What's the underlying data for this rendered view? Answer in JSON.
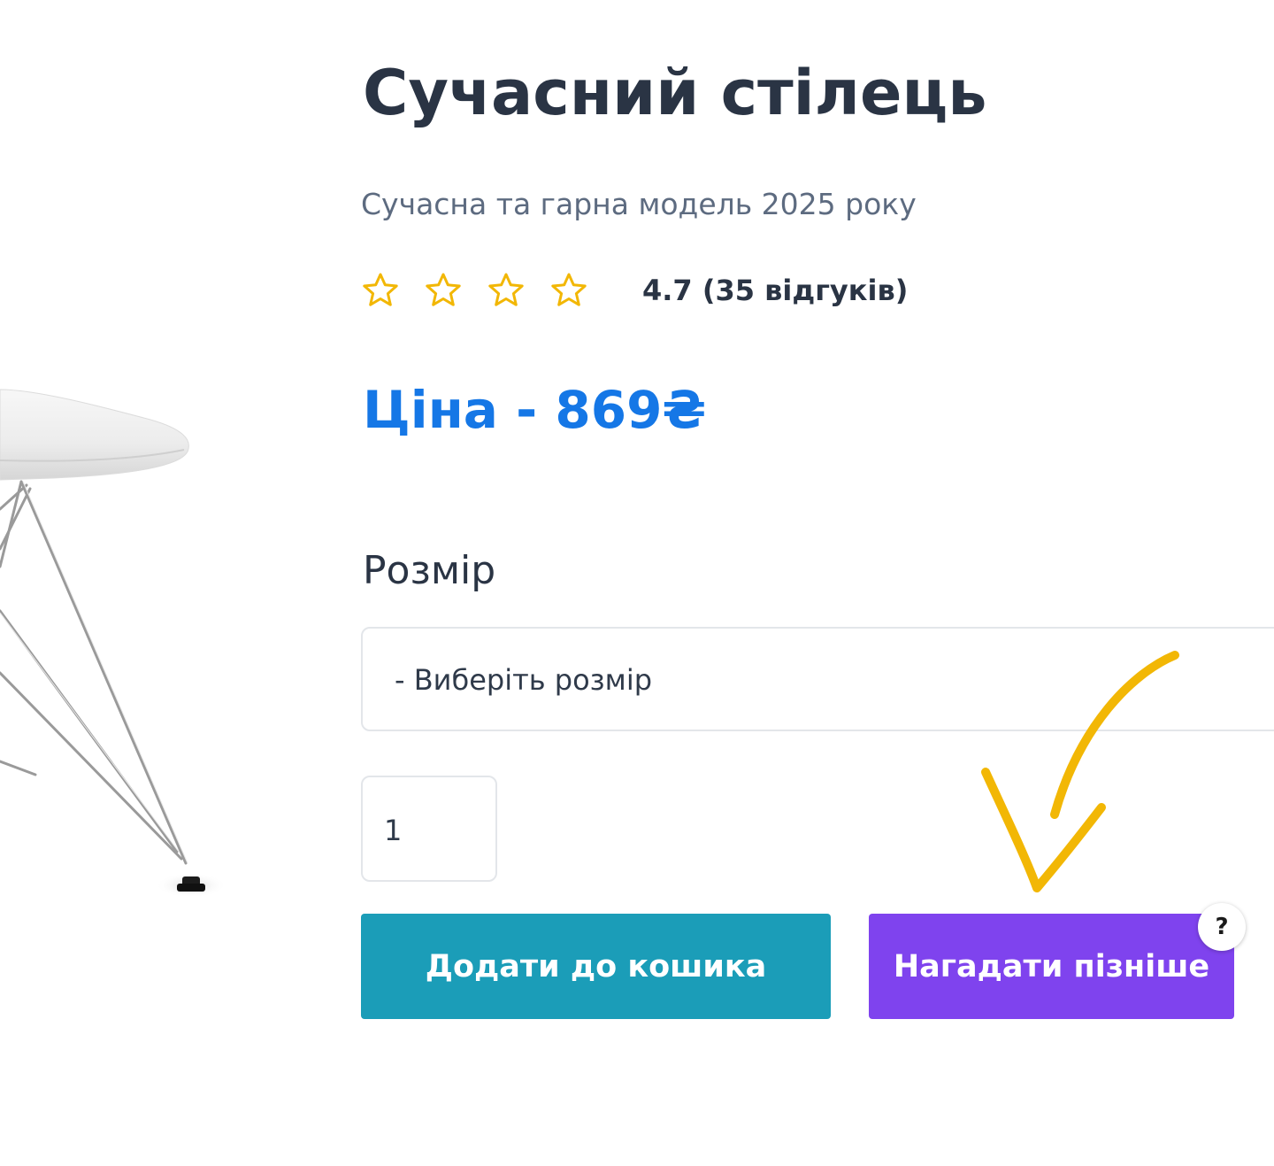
{
  "product": {
    "title": "Сучасний стілець",
    "subtitle": "Сучасна та гарна модель 2025 року",
    "rating": {
      "stars_shown": 4,
      "text": "4.7 (35 відгуків)"
    },
    "price": "Ціна - 869₴",
    "size": {
      "label": "Розмір",
      "selected": "- Виберіть розмір"
    },
    "quantity": "1",
    "buttons": {
      "add_to_cart": "Додати до кошика",
      "remind_later": "Нагадати пізніше",
      "help": "?"
    }
  },
  "colors": {
    "title": "#2a3444",
    "subtitle": "#5d6b80",
    "price": "#1577e6",
    "star": "#f2b705",
    "add_to_cart_bg": "#1b9db8",
    "remind_later_bg": "#7f43ee",
    "arrow": "#f2b705"
  },
  "icons": {
    "stars": "star-outline-icon",
    "help": "question-icon",
    "arrow": "hand-drawn-arrow-icon",
    "chair": "chair-image"
  }
}
